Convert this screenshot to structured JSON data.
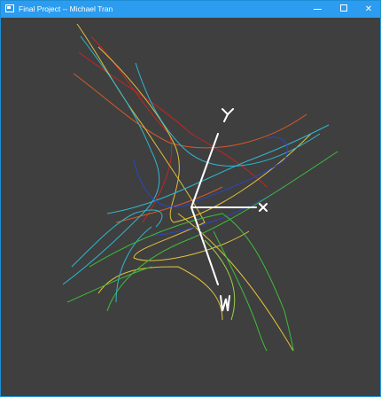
{
  "window": {
    "title": "Final Project -- Michael Tran",
    "controls": {
      "minimize": "minimize",
      "maximize": "maximize",
      "close": "close"
    }
  },
  "scene": {
    "background": "#3f3f3f",
    "axis_color": "#ffffff",
    "axis_labels": [
      "X",
      "Y",
      "W"
    ],
    "curve_colors": [
      "#e0c23a",
      "#d65a2a",
      "#2fb7cf",
      "#3cbf3a",
      "#2a46c8",
      "#c82424",
      "#9ad14a"
    ]
  }
}
